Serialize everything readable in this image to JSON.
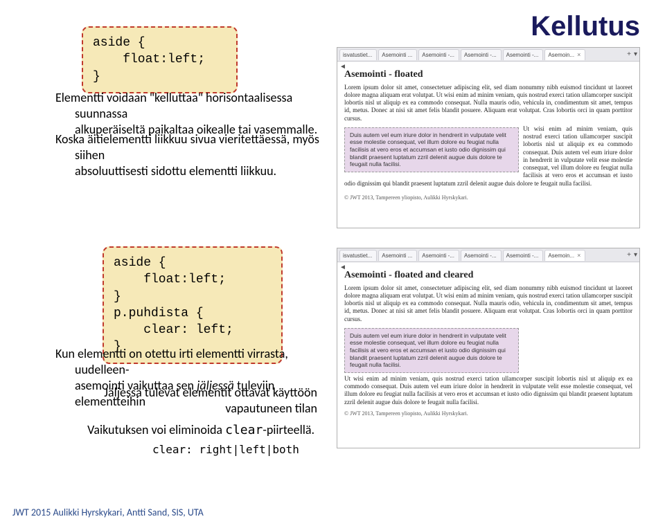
{
  "title": "Kellutus",
  "footer": "JWT 2015 Aulikki Hyrskykari, Antti Sand, SIS, UTA",
  "code1": "aside {\n    float:left;\n}",
  "code2": "aside {\n    float:left;\n}\np.puhdista {\n    clear: left;\n}",
  "text": {
    "p1a": "Elementti voidaan \"kelluttaa\" horisontaalisessa suunnassa",
    "p1b": "alkuperäiseltä paikaltaa oikealle tai vasemmalle.",
    "p2a": "Koska äitielementti liikkuu sivua vieritettäessä, myös siihen",
    "p2b": "absoluuttisesti sidottu elementti liikkuu.",
    "p3a": "Kun elementti on otettu irti elementti virrasta, uudelleen-",
    "p3b": "asemointi vaikuttaa  sen ",
    "p3b_italic": "jäljessä",
    "p3b_end": " tuleviin elementteihin",
    "p4a": "Jäljessä tulevat elementit ottavat käyttöön",
    "p4b": "vapautuneen tilan",
    "p5a": "Vaikutuksen voi eliminoida ",
    "p5b_mono": "clear",
    "p5c": "-piirteellä.",
    "p6": "clear: right|left|both"
  },
  "browser1": {
    "tabs": [
      "isvatustiet...",
      "Asemointi ...",
      "Asemointi -...",
      "Asemointi -...",
      "Asemointi -...",
      "Asemoin..."
    ],
    "activeTab": 5,
    "heading": "Asemointi - floated",
    "para1": "Lorem ipsum dolor sit amet, consectetuer adipiscing elit, sed diam nonummy nibh euismod tincidunt ut laoreet dolore magna aliquam erat volutpat. Ut wisi enim ad minim veniam, quis nostrud exerci tation ullamcorper suscipit lobortis nisl ut aliquip ex ea commodo consequat. Nulla mauris odio, vehicula in, condimentum sit amet, tempus id, metus. Donec at nisi sit amet felis blandit posuere. Aliquam erat volutpat. Cras lobortis orci in quam porttitor cursus.",
    "floated": "Duis autem vel eum iriure dolor in hendrerit in vulputate velit esse molestie consequat, vel illum dolore eu feugiat nulla facilisis at vero eros et accumsan et iusto odio dignissim qui blandit praesent luptatum zzril delenit augue duis dolore te feugait nulla facilisi.",
    "wrap": "Ut wisi enim ad minim veniam, quis nostrud exerci tation ullamcorper suscipit lobortis nisl ut aliquip ex ea commodo consequat. Duis autem vel eum iriure dolor in hendrerit in vulputate velit esse molestie consequat, vel illum dolore eu feugiat nulla facilisis at vero eros et accumsan et iusto odio dignissim qui blandit praesent luptatum zzril delenit augue duis dolore te feugait nulla facilisi.",
    "copy": "© JWT 2013, Tampereen yliopisto, Aulikki Hyrskykari."
  },
  "browser2": {
    "tabs": [
      "isvatustiet...",
      "Asemointi ...",
      "Asemointi -...",
      "Asemointi -...",
      "Asemointi -...",
      "Asemoin..."
    ],
    "activeTab": 5,
    "heading": "Asemointi - floated and cleared",
    "para1": "Lorem ipsum dolor sit amet, consectetuer adipiscing elit, sed diam nonummy nibh euismod tincidunt ut laoreet dolore magna aliquam erat volutpat. Ut wisi enim ad minim veniam, quis nostrud exerci tation ullamcorper suscipit lobortis nisl ut aliquip ex ea commodo consequat. Nulla mauris odio, vehicula in, condimentum sit amet, tempus id, metus. Donec at nisi sit amet felis blandit posuere. Aliquam erat volutpat. Cras lobortis orci in quam porttitor cursus.",
    "floated": "Duis autem vel eum iriure dolor in hendrerit in vulputate velit esse molestie consequat, vel illum dolore eu feugiat nulla facilisis at vero eros et accumsan et iusto odio dignissim qui blandit praesent luptatum zzril delenit augue duis dolore te feugait nulla facilisi.",
    "clearedPara": "Ut wisi enim ad minim veniam, quis nostrud exerci tation ullamcorper suscipit lobortis nisl ut aliquip ex ea commodo consequat. Duis autem vel eum iriure dolor in hendrerit in vulputate velit esse molestie consequat, vel illum dolore eu feugiat nulla facilisis at vero eros et accumsan et iusto odio dignissim qui blandit praesent luptatum zzril delenit augue duis dolore te feugait nulla facilisi.",
    "copy": "© JWT 2013, Tampereen yliopisto, Aulikki Hyrskykari."
  }
}
